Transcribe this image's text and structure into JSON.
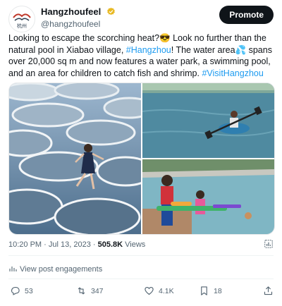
{
  "author": {
    "display_name": "Hangzhoufeel",
    "handle": "@hangzhoufeel",
    "logo_caption": "杭州"
  },
  "header": {
    "promote_label": "Promote"
  },
  "post": {
    "text_part1": "Looking to escape the scorching heat?",
    "emoji_sun": "😎",
    "text_part2": " Look no further than the natural pool in Xiabao village, ",
    "hashtag_hangzhou": "#Hangzhou",
    "text_part3": "! The water area",
    "emoji_drops": "💦",
    "text_part4": " spans over 20,000 sq m and now features a water park, a swimming pool, and an area for children to catch fish and shrimp. ",
    "hashtag_visit": "#VisitHangzhou"
  },
  "meta": {
    "time": "10:20 PM",
    "separator": " · ",
    "date": "Jul 13, 2023",
    "views_count": "505.8K",
    "views_label": " Views"
  },
  "engagements_label": "View post engagements",
  "actions": {
    "replies": "53",
    "reposts": "347",
    "likes": "4.1K",
    "bookmarks": "18"
  }
}
